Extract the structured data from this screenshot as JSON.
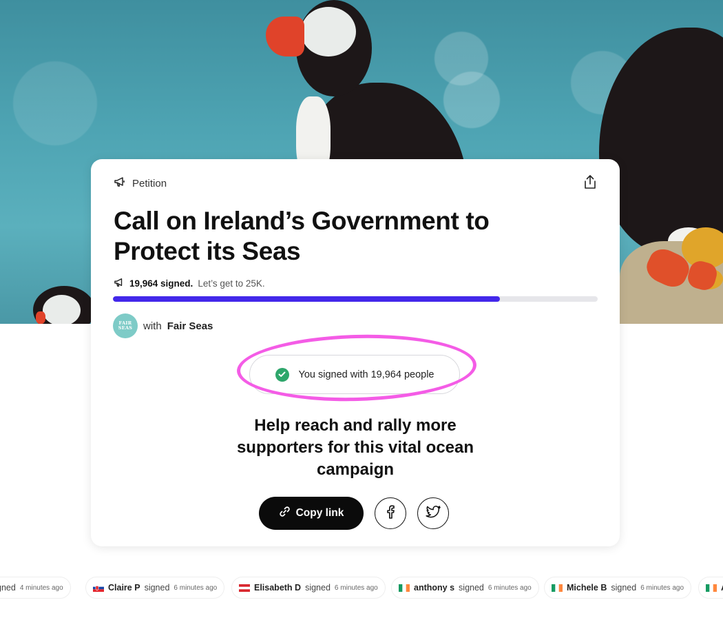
{
  "petition": {
    "badge_label": "Petition",
    "title": "Call on Ireland’s Government to Protect its Seas",
    "signed_count": "19,964 signed.",
    "goal_text": "Let’s get to 25K.",
    "progress_fraction": 0.7986,
    "with_label": "with",
    "org_name": "Fair Seas",
    "org_logo_text": [
      "FAIR",
      "SEAS"
    ],
    "signed_status": "You signed with 19,964 people",
    "cta": "Help reach and rally more supporters for this vital ocean campaign",
    "copy_link_label": "Copy link"
  },
  "icons": {
    "badge": "megaphone-icon",
    "share": "share-icon",
    "progress": "megaphone-icon",
    "status": "check-circle-icon",
    "copy": "link-icon",
    "facebook": "facebook-icon",
    "twitter": "twitter-icon"
  },
  "colors": {
    "progress_fill": "#4328ea",
    "check": "#2ea66b",
    "highlight_ring": "#f45ce6",
    "copy_button": "#0b0b0b"
  },
  "recent_signers": [
    {
      "name": "",
      "verb": "gned",
      "time": "4 minutes ago",
      "flag": "none"
    },
    {
      "name": "Claire P",
      "verb": "signed",
      "time": "6 minutes ago",
      "flag": "slovakia"
    },
    {
      "name": "Elisabeth D",
      "verb": "signed",
      "time": "6 minutes ago",
      "flag": "austria"
    },
    {
      "name": "anthony s",
      "verb": "signed",
      "time": "6 minutes ago",
      "flag": "ireland"
    },
    {
      "name": "Michele B",
      "verb": "signed",
      "time": "6 minutes ago",
      "flag": "ireland"
    },
    {
      "name": "A",
      "verb": "",
      "time": "",
      "flag": "ireland"
    }
  ]
}
